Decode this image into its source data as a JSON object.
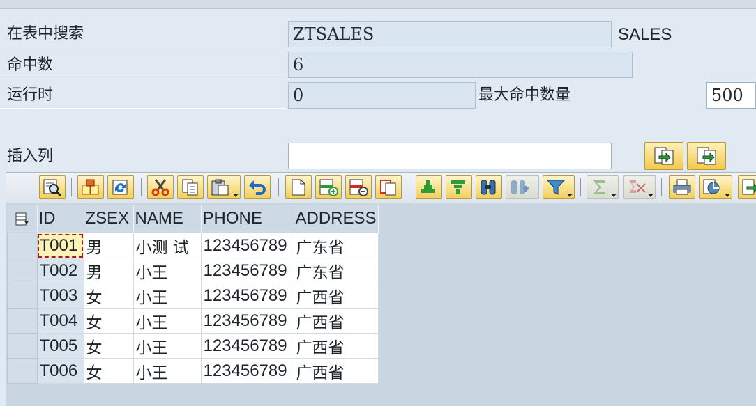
{
  "form": {
    "search_label": "在表中搜索",
    "search_value": "ZTSALES",
    "search_desc": "SALES",
    "hits_label": "命中数",
    "hits_value": "6",
    "runtime_label": "运行时",
    "runtime_value": "0",
    "max_hits_label": "最大命中数量",
    "max_hits_value": "500",
    "insert_col_label": "插入列",
    "insert_col_value": ""
  },
  "toolbar": {
    "icons": [
      "details-icon",
      "check-icon",
      "refresh-icon",
      "cut-icon",
      "copy-icon",
      "paste-icon",
      "undo-icon",
      "new-row-icon",
      "insert-row-icon",
      "delete-row-icon",
      "duplicate-row-icon",
      "sort-asc-icon",
      "sort-desc-icon",
      "find-icon",
      "find-next-icon",
      "filter-icon",
      "sum-icon",
      "subtotal-icon",
      "print-icon",
      "views-icon",
      "export-icon"
    ]
  },
  "table": {
    "columns": [
      "ID",
      "ZSEX",
      "NAME",
      "PHONE",
      "ADDRESS"
    ],
    "rows": [
      [
        "T001",
        "男",
        "小测 试",
        "123456789",
        "广东省"
      ],
      [
        "T002",
        "男",
        "小王",
        "123456789",
        "广东省"
      ],
      [
        "T003",
        "女",
        "小王",
        "123456789",
        "广西省"
      ],
      [
        "T004",
        "女",
        "小王",
        "123456789",
        "广西省"
      ],
      [
        "T005",
        "女",
        "小王",
        "123456789",
        "广西省"
      ],
      [
        "T006",
        "女",
        "小王",
        "123456789",
        "广西省"
      ]
    ]
  },
  "colors": {
    "background": "#e1e9f2",
    "button_yellow": "#f3c84c",
    "key_column": "#d9e4ef",
    "focus_cell": "#fdf2b7"
  }
}
